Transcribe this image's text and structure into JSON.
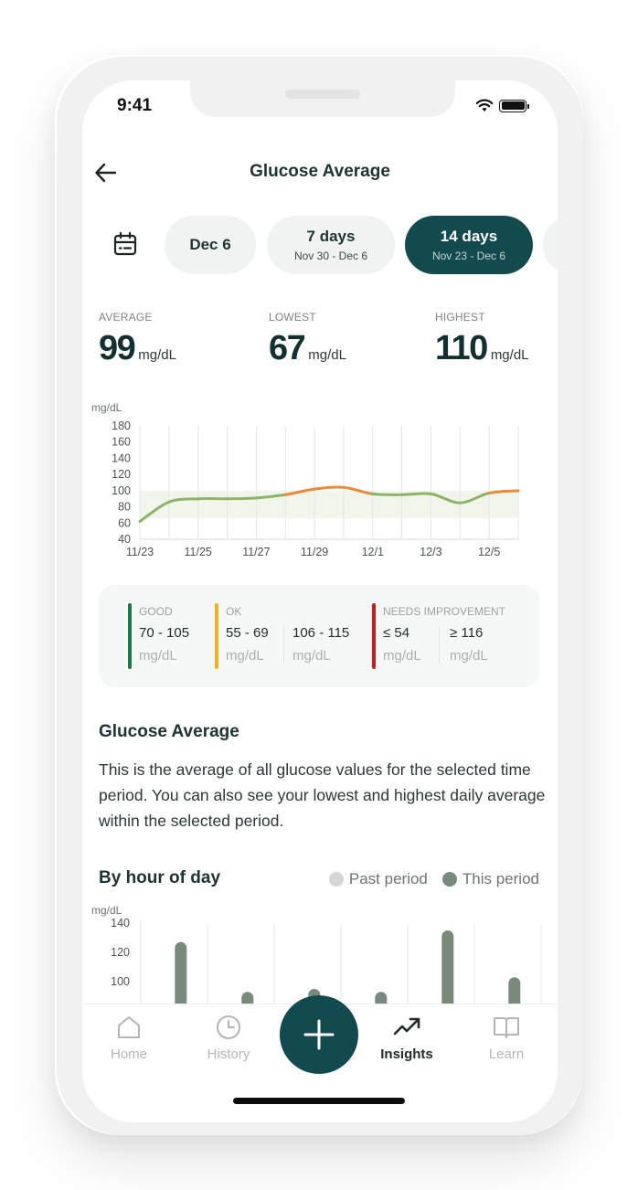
{
  "status_bar": {
    "time": "9:41",
    "wifi_icon": "wifi-icon",
    "battery_icon": "battery-icon"
  },
  "header": {
    "title": "Glucose Average",
    "back_icon": "arrow-left-icon"
  },
  "range_selector": {
    "calendar_icon": "calendar-icon",
    "options": [
      {
        "label": "Dec 6",
        "sub": ""
      },
      {
        "label": "7 days",
        "sub": "Nov 30 - Dec 6"
      },
      {
        "label": "14 days",
        "sub": "Nov 23 - Dec 6",
        "active": true
      }
    ]
  },
  "stats": {
    "average": {
      "label": "AVERAGE",
      "value": "99",
      "unit": "mg/dL"
    },
    "lowest": {
      "label": "LOWEST",
      "value": "67",
      "unit": "mg/dL"
    },
    "highest": {
      "label": "HIGHEST",
      "value": "110",
      "unit": "mg/dL"
    }
  },
  "chart_data": [
    {
      "type": "line",
      "title": "Glucose Average",
      "ylabel": "mg/dL",
      "xlabel": "",
      "ylim": [
        40,
        180
      ],
      "yticks": [
        180,
        160,
        140,
        120,
        100,
        80,
        60,
        40
      ],
      "x": [
        "11/23",
        "11/24",
        "11/25",
        "11/26",
        "11/27",
        "11/28",
        "11/29",
        "11/30",
        "12/1",
        "12/2",
        "12/3",
        "12/4",
        "12/5",
        "12/6"
      ],
      "xtick_labels": [
        "11/23",
        "11/25",
        "11/27",
        "11/29",
        "12/1",
        "12/3",
        "12/5"
      ],
      "values": [
        62,
        86,
        90,
        90,
        91,
        95,
        102,
        104,
        96,
        95,
        96,
        85,
        97,
        100
      ],
      "target_band": [
        66,
        100
      ],
      "grid": "vertical",
      "colors": {
        "in_range": "#8db36b",
        "above": "#e98a3c",
        "band": "#f1f6ea",
        "grid": "#e6e6e6"
      }
    },
    {
      "type": "bar",
      "title": "By hour of day",
      "ylabel": "mg/dL",
      "ylim": [
        85,
        140
      ],
      "yticks": [
        140,
        120,
        100
      ],
      "legend": [
        {
          "name": "Past period",
          "color": "#d6d6d6"
        },
        {
          "name": "This period",
          "color": "#778a7b"
        }
      ],
      "legend_position": "top-right",
      "series": [
        {
          "name": "This period",
          "values": [
            127,
            93,
            95,
            93,
            135,
            103
          ]
        }
      ]
    }
  ],
  "legend_card": {
    "good": {
      "title": "GOOD",
      "color": "#1a7a45",
      "ranges": [
        "70 - 105"
      ],
      "unit": "mg/dL"
    },
    "ok": {
      "title": "OK",
      "color": "#f2b21e",
      "ranges": [
        "55 - 69",
        "106 - 115"
      ],
      "unit": "mg/dL"
    },
    "needs_improvement": {
      "title": "NEEDS IMPROVEMENT",
      "color": "#c81e1e",
      "ranges": [
        "≤ 54",
        "≥ 116"
      ],
      "unit": "mg/dL"
    }
  },
  "description": {
    "title": "Glucose Average",
    "body": "This is the average of all glucose values for the selected time period. You can also see your lowest and highest daily average within the selected period."
  },
  "hour_section": {
    "title": "By hour of day",
    "legend_past": "Past period",
    "legend_this": "This period"
  },
  "tabbar": {
    "items": [
      {
        "label": "Home",
        "icon": "home-icon"
      },
      {
        "label": "History",
        "icon": "clock-icon"
      },
      {
        "label": "Insights",
        "icon": "trending-up-icon",
        "active": true
      },
      {
        "label": "Learn",
        "icon": "book-open-icon"
      }
    ],
    "fab_icon": "plus-icon"
  },
  "colors": {
    "primary": "#124a4e",
    "text": "#1f3331"
  }
}
